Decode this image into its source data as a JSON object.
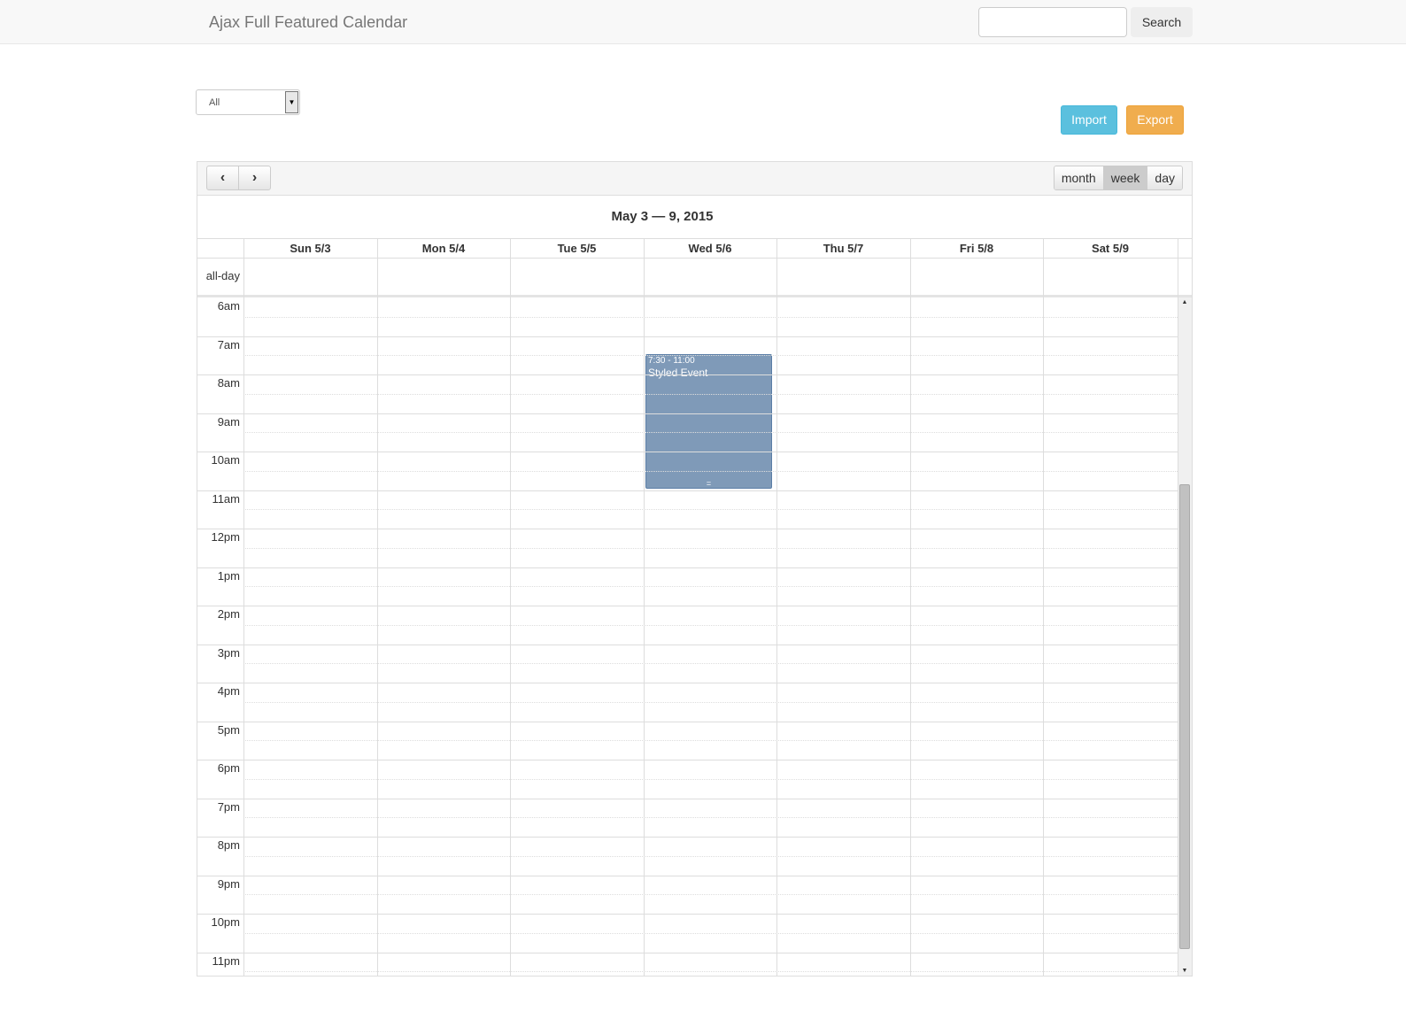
{
  "navbar": {
    "brand": "Ajax Full Featured Calendar",
    "search_placeholder": "",
    "search_label": "Search"
  },
  "filter": {
    "selected": "All"
  },
  "actions": {
    "import": "Import",
    "export": "Export"
  },
  "calendar": {
    "title": "May 3 — 9, 2015",
    "views": [
      "month",
      "week",
      "day"
    ],
    "active_view": "week",
    "days": [
      "Sun 5/3",
      "Mon 5/4",
      "Tue 5/5",
      "Wed 5/6",
      "Thu 5/7",
      "Fri 5/8",
      "Sat 5/9"
    ],
    "allday_label": "all-day",
    "hours": [
      "6am",
      "7am",
      "8am",
      "9am",
      "10am",
      "11am",
      "12pm",
      "1pm",
      "2pm",
      "3pm",
      "4pm",
      "5pm",
      "6pm",
      "7pm",
      "8pm",
      "9pm",
      "10pm",
      "11pm"
    ],
    "events": [
      {
        "time": "7:30 - 11:00",
        "title": "Styled Event",
        "day": "Wed 5/6",
        "start": 7.5,
        "end": 11,
        "color": "#7f9ab8"
      }
    ]
  }
}
